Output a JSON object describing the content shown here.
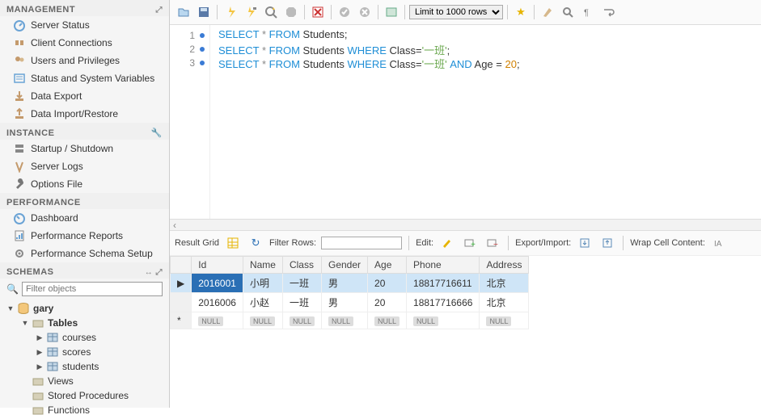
{
  "sidebar": {
    "management": {
      "title": "MANAGEMENT",
      "items": [
        {
          "label": "Server Status"
        },
        {
          "label": "Client Connections"
        },
        {
          "label": "Users and Privileges"
        },
        {
          "label": "Status and System Variables"
        },
        {
          "label": "Data Export"
        },
        {
          "label": "Data Import/Restore"
        }
      ]
    },
    "instance": {
      "title": "INSTANCE",
      "items": [
        {
          "label": "Startup / Shutdown"
        },
        {
          "label": "Server Logs"
        },
        {
          "label": "Options File"
        }
      ]
    },
    "performance": {
      "title": "PERFORMANCE",
      "items": [
        {
          "label": "Dashboard"
        },
        {
          "label": "Performance Reports"
        },
        {
          "label": "Performance Schema Setup"
        }
      ]
    },
    "schemas": {
      "title": "SCHEMAS",
      "filter_placeholder": "Filter objects",
      "db": "gary",
      "folders": {
        "tables": "Tables",
        "views": "Views",
        "procs": "Stored Procedures",
        "funcs": "Functions"
      },
      "tables": [
        "courses",
        "scores",
        "students"
      ]
    }
  },
  "toolbar": {
    "limit_label": "Limit to 1000 rows"
  },
  "sql": {
    "lines": [
      {
        "n": "1",
        "html": "<span class='kw'>SELECT</span> <span class='op'>*</span> <span class='kw'>FROM</span> Students;"
      },
      {
        "n": "2",
        "html": "<span class='kw'>SELECT</span> <span class='op'>*</span> <span class='kw'>FROM</span> Students <span class='kw'>WHERE</span> Class=<span class='str'>'一班'</span>;"
      },
      {
        "n": "3",
        "html": "<span class='kw'>SELECT</span> <span class='op'>*</span> <span class='kw'>FROM</span> Students <span class='kw'>WHERE</span> Class=<span class='str'>'一班'</span> <span class='kw'>AND</span> Age = <span class='num'>20</span>;"
      }
    ]
  },
  "result_toolbar": {
    "result_grid": "Result Grid",
    "filter_rows": "Filter Rows:",
    "filter_value": "",
    "edit": "Edit:",
    "export_import": "Export/Import:",
    "wrap": "Wrap Cell Content:"
  },
  "grid": {
    "columns": [
      "Id",
      "Name",
      "Class",
      "Gender",
      "Age",
      "Phone",
      "Address"
    ],
    "rows": [
      {
        "sel": true,
        "cells": [
          "2016001",
          "小明",
          "一班",
          "男",
          "20",
          "18817716611",
          "北京"
        ]
      },
      {
        "sel": false,
        "cells": [
          "2016006",
          "小赵",
          "一班",
          "男",
          "20",
          "18817716666",
          "北京"
        ]
      }
    ],
    "null_label": "NULL"
  }
}
